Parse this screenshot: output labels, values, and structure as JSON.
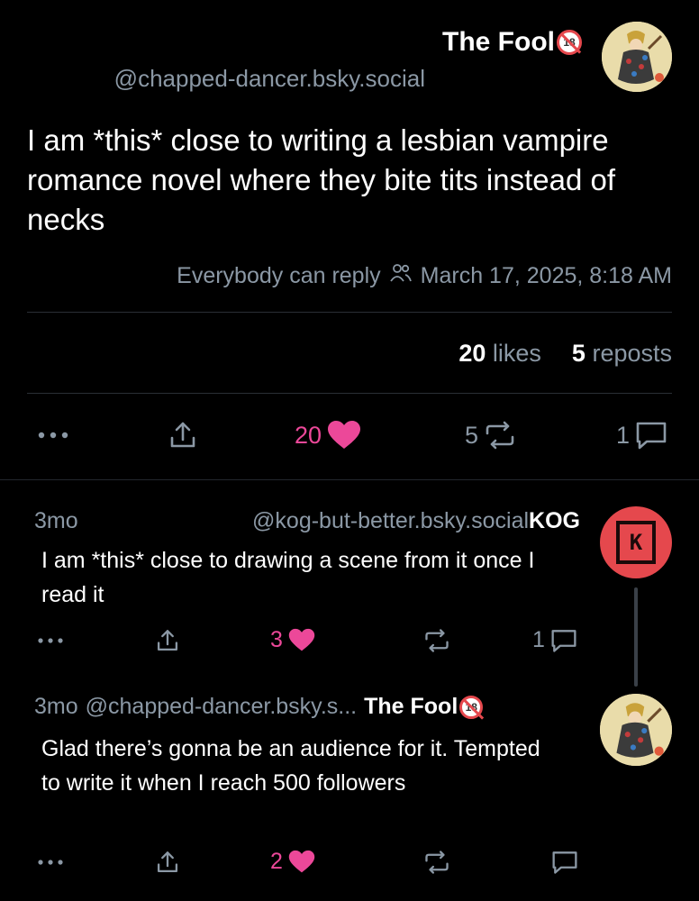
{
  "post": {
    "display_name": "The Fool",
    "nsfw_badge": "18",
    "handle": "@chapped-dancer.bsky.social",
    "text": "I am *this* close to writing a lesbian vampire romance novel where they bite tits instead of necks",
    "reply_setting": "Everybody can reply",
    "timestamp": "March 17, 2025, 8:18 AM",
    "likes_count": "20",
    "likes_label": "likes",
    "reposts_count": "5",
    "reposts_label": "reposts",
    "actions": {
      "like_count": "20",
      "repost_count": "5",
      "reply_count": "1"
    },
    "accent_color": "#ec4899"
  },
  "replies": [
    {
      "age": "3mo",
      "handle": "@kog-but-better.bsky.social",
      "display_name": "KOG",
      "text": "I am *this* close to drawing a scene from it once I read it",
      "like_count": "3",
      "reply_count": "1",
      "avatar_text": "K"
    },
    {
      "age": "3mo",
      "handle": "@chapped-dancer.bsky.s...",
      "display_name": "The Fool",
      "nsfw_badge": "18",
      "text": "Glad there’s gonna be an audience for it. Tempted to write it when I reach 500 followers",
      "like_count": "2"
    }
  ]
}
